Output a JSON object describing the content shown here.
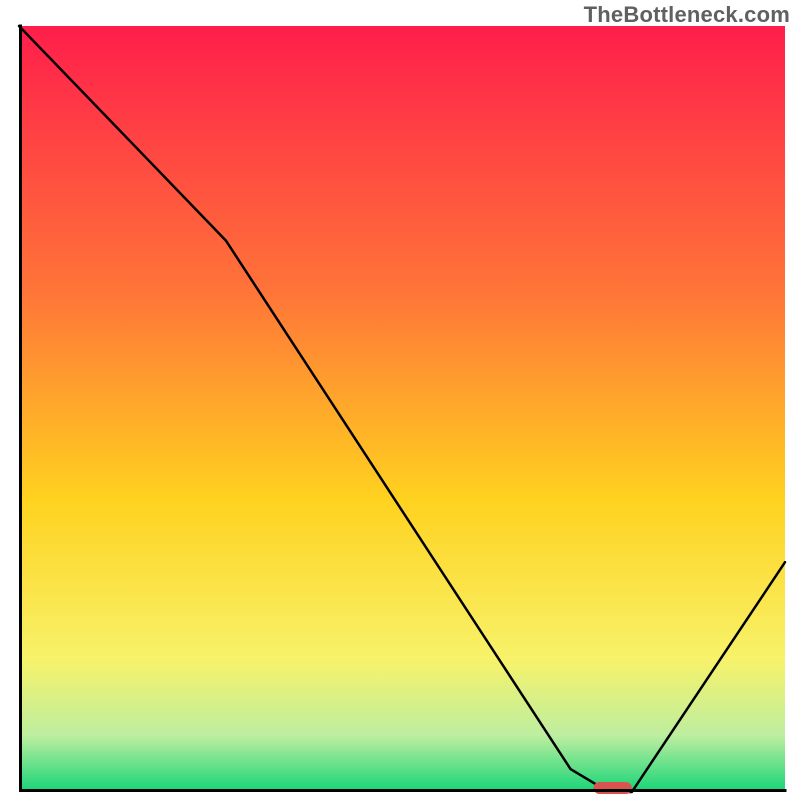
{
  "watermark": "TheBottleneck.com",
  "chart_data": {
    "type": "line",
    "title": "",
    "xlabel": "",
    "ylabel": "",
    "xlim": [
      0,
      100
    ],
    "ylim": [
      0,
      100
    ],
    "x": [
      0,
      27,
      72,
      77,
      80,
      100
    ],
    "values": [
      100,
      72,
      3,
      0,
      0,
      30
    ],
    "marker": {
      "x_start": 75,
      "x_end": 80,
      "y": 0,
      "color": "#d9534f"
    },
    "gradient_stops": [
      {
        "offset": 0.0,
        "color": "#ff1e4b"
      },
      {
        "offset": 0.35,
        "color": "#ff7538"
      },
      {
        "offset": 0.62,
        "color": "#ffd21f"
      },
      {
        "offset": 0.83,
        "color": "#f7f26a"
      },
      {
        "offset": 0.93,
        "color": "#bdeea0"
      },
      {
        "offset": 1.0,
        "color": "#1fd67a"
      }
    ],
    "axis_color": "#000000",
    "axis_width": 3,
    "line_color": "#000000",
    "line_width": 2.5
  }
}
